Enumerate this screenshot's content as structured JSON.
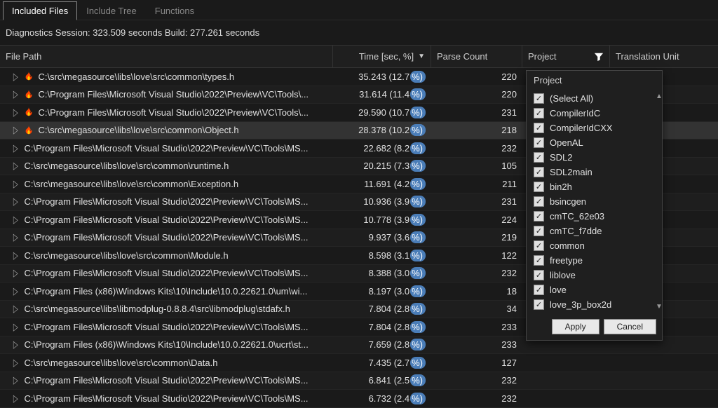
{
  "tabs": [
    {
      "label": "Included Files",
      "active": true
    },
    {
      "label": "Include Tree",
      "active": false
    },
    {
      "label": "Functions",
      "active": false
    }
  ],
  "status": "Diagnostics Session: 323.509 seconds  Build: 277.261 seconds",
  "columns": {
    "path": "File Path",
    "time": "Time [sec, %]",
    "parse": "Parse Count",
    "project": "Project",
    "trans": "Translation Unit"
  },
  "rows": [
    {
      "path": "C:\\src\\megasource\\libs\\love\\src\\common\\types.h",
      "time": "35.243 (12.7",
      "pct": "%)",
      "parse": "220",
      "flame": true
    },
    {
      "path": "C:\\Program Files\\Microsoft Visual Studio\\2022\\Preview\\VC\\Tools\\...",
      "time": "31.614 (11.4",
      "pct": "%)",
      "parse": "220",
      "flame": true
    },
    {
      "path": "C:\\Program Files\\Microsoft Visual Studio\\2022\\Preview\\VC\\Tools\\...",
      "time": "29.590 (10.7",
      "pct": "%)",
      "parse": "231",
      "flame": true
    },
    {
      "path": "C:\\src\\megasource\\libs\\love\\src\\common\\Object.h",
      "time": "28.378 (10.2",
      "pct": "%)",
      "parse": "218",
      "flame": true,
      "highlight": true
    },
    {
      "path": "C:\\Program Files\\Microsoft Visual Studio\\2022\\Preview\\VC\\Tools\\MS...",
      "time": "22.682 (8.2",
      "pct": "%)",
      "parse": "232"
    },
    {
      "path": "C:\\src\\megasource\\libs\\love\\src\\common\\runtime.h",
      "time": "20.215 (7.3",
      "pct": "%)",
      "parse": "105"
    },
    {
      "path": "C:\\src\\megasource\\libs\\love\\src\\common\\Exception.h",
      "time": "11.691 (4.2",
      "pct": "%)",
      "parse": "211"
    },
    {
      "path": "C:\\Program Files\\Microsoft Visual Studio\\2022\\Preview\\VC\\Tools\\MS...",
      "time": "10.936 (3.9",
      "pct": "%)",
      "parse": "231"
    },
    {
      "path": "C:\\Program Files\\Microsoft Visual Studio\\2022\\Preview\\VC\\Tools\\MS...",
      "time": "10.778 (3.9",
      "pct": "%)",
      "parse": "224"
    },
    {
      "path": "C:\\Program Files\\Microsoft Visual Studio\\2022\\Preview\\VC\\Tools\\MS...",
      "time": "9.937 (3.6",
      "pct": "%)",
      "parse": "219"
    },
    {
      "path": "C:\\src\\megasource\\libs\\love\\src\\common\\Module.h",
      "time": "8.598 (3.1",
      "pct": "%)",
      "parse": "122"
    },
    {
      "path": "C:\\Program Files\\Microsoft Visual Studio\\2022\\Preview\\VC\\Tools\\MS...",
      "time": "8.388 (3.0",
      "pct": "%)",
      "parse": "232"
    },
    {
      "path": "C:\\Program Files (x86)\\Windows Kits\\10\\Include\\10.0.22621.0\\um\\wi...",
      "time": "8.197 (3.0",
      "pct": "%)",
      "parse": "18"
    },
    {
      "path": "C:\\src\\megasource\\libs\\libmodplug-0.8.8.4\\src\\libmodplug\\stdafx.h",
      "time": "7.804 (2.8",
      "pct": "%)",
      "parse": "34"
    },
    {
      "path": "C:\\Program Files\\Microsoft Visual Studio\\2022\\Preview\\VC\\Tools\\MS...",
      "time": "7.804 (2.8",
      "pct": "%)",
      "parse": "233"
    },
    {
      "path": "C:\\Program Files (x86)\\Windows Kits\\10\\Include\\10.0.22621.0\\ucrt\\st...",
      "time": "7.659 (2.8",
      "pct": "%)",
      "parse": "233"
    },
    {
      "path": "C:\\src\\megasource\\libs\\love\\src\\common\\Data.h",
      "time": "7.435 (2.7",
      "pct": "%)",
      "parse": "127"
    },
    {
      "path": "C:\\Program Files\\Microsoft Visual Studio\\2022\\Preview\\VC\\Tools\\MS...",
      "time": "6.841 (2.5",
      "pct": "%)",
      "parse": "232"
    },
    {
      "path": "C:\\Program Files\\Microsoft Visual Studio\\2022\\Preview\\VC\\Tools\\MS...",
      "time": "6.732 (2.4",
      "pct": "%)",
      "parse": "232"
    }
  ],
  "filter": {
    "title": "Project",
    "items": [
      "(Select All)",
      "CompilerIdC",
      "CompilerIdCXX",
      "OpenAL",
      "SDL2",
      "SDL2main",
      "bin2h",
      "bsincgen",
      "cmTC_62e03",
      "cmTC_f7dde",
      "common",
      "freetype",
      "liblove",
      "love",
      "love_3p_box2d"
    ],
    "apply": "Apply",
    "cancel": "Cancel"
  }
}
